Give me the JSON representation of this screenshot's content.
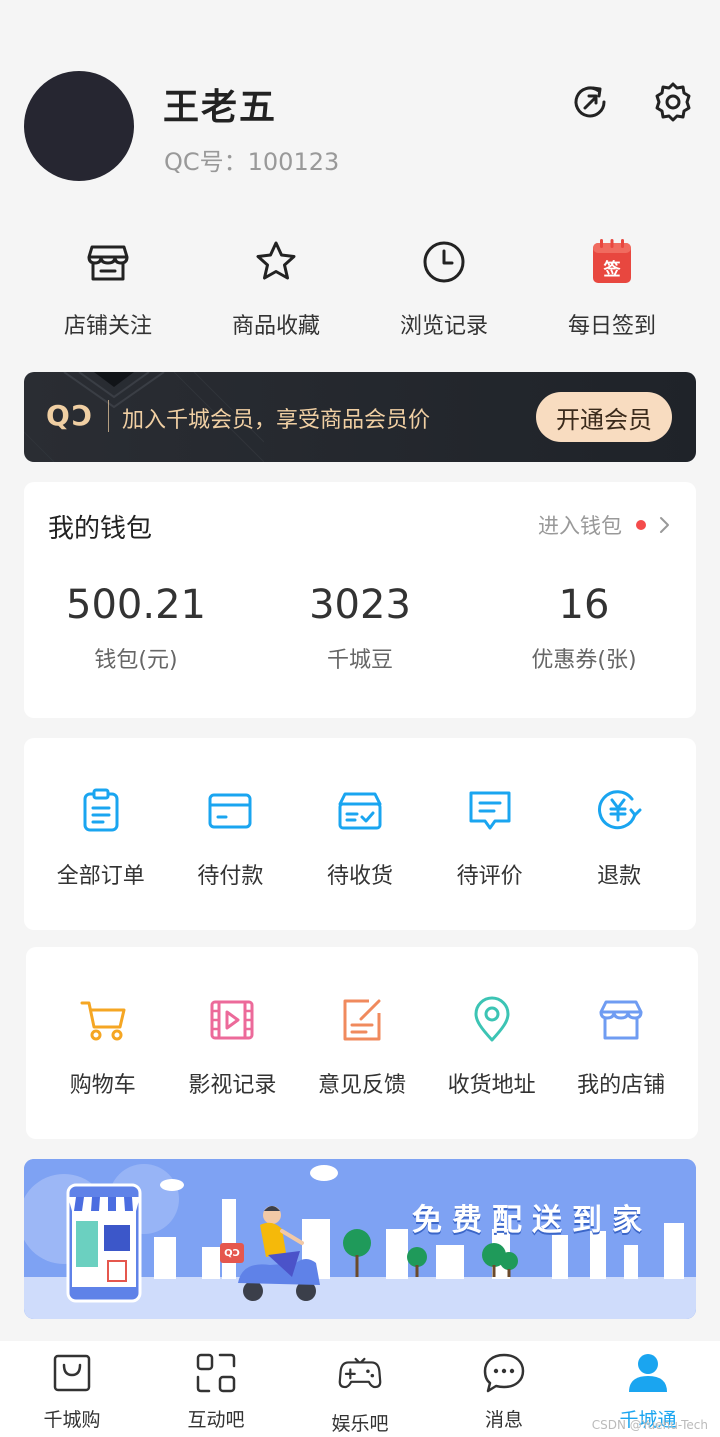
{
  "profile": {
    "name": "王老五",
    "qc_id": "QC号：100123",
    "avatar_color": "#262631"
  },
  "top_actions": [
    {
      "icon": "refresh-icon"
    },
    {
      "icon": "gear-icon"
    }
  ],
  "quick_links": [
    {
      "label": "店铺关注",
      "icon": "store-icon"
    },
    {
      "label": "商品收藏",
      "icon": "star-icon"
    },
    {
      "label": "浏览记录",
      "icon": "clock-icon"
    },
    {
      "label": "每日签到",
      "icon": "calendar-sign-icon",
      "icon_text": "签"
    }
  ],
  "vip": {
    "logo": "QↃ",
    "text": "加入千城会员，享受商品会员价",
    "button": "开通会员",
    "accent": "#f0cfa3"
  },
  "wallet": {
    "title": "我的钱包",
    "link": "进入钱包",
    "stats": [
      {
        "value": "500.21",
        "label": "钱包(元)"
      },
      {
        "value": "3023",
        "label": "千城豆"
      },
      {
        "value": "16",
        "label": "优惠券(张)"
      }
    ]
  },
  "orders": [
    {
      "label": "全部订单",
      "icon": "clipboard-icon"
    },
    {
      "label": "待付款",
      "icon": "card-icon"
    },
    {
      "label": "待收货",
      "icon": "box-check-icon"
    },
    {
      "label": "待评价",
      "icon": "comment-icon"
    },
    {
      "label": "退款",
      "icon": "yen-refund-icon"
    }
  ],
  "tools": [
    {
      "label": "购物车",
      "icon": "cart-icon",
      "color": "#f5a623"
    },
    {
      "label": "影视记录",
      "icon": "video-icon",
      "color": "#ec6a9a"
    },
    {
      "label": "意见反馈",
      "icon": "edit-note-icon",
      "color": "#f08a5d"
    },
    {
      "label": "收货地址",
      "icon": "location-pin-icon",
      "color": "#3cc4b4"
    },
    {
      "label": "我的店铺",
      "icon": "shop-icon",
      "color": "#6f9cf2"
    }
  ],
  "banner": {
    "title": "免费配送到家",
    "bike_badge": "QↃ"
  },
  "tabbar": [
    {
      "label": "千城购",
      "icon": "shopping-bag-icon",
      "active": false
    },
    {
      "label": "互动吧",
      "icon": "scan-icon",
      "active": false
    },
    {
      "label": "娱乐吧",
      "icon": "gamepad-icon",
      "active": false
    },
    {
      "label": "消息",
      "icon": "chat-bubble-icon",
      "active": false
    },
    {
      "label": "千城通",
      "icon": "user-icon",
      "active": true
    }
  ],
  "watermark": "CSDN @Yuehu-Tech",
  "colors": {
    "primary_blue": "#1aa5f0",
    "background": "#f5f5f5"
  }
}
